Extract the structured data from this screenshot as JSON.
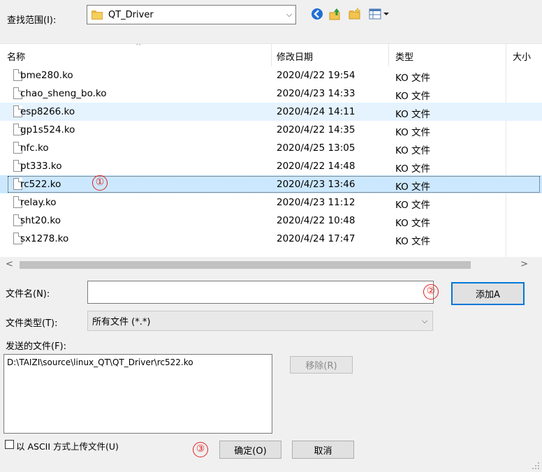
{
  "look_in": {
    "label": "查找范围(I):",
    "folder": "QT_Driver"
  },
  "columns": {
    "name": "名称",
    "date": "修改日期",
    "type": "类型",
    "size": "大小"
  },
  "files": [
    {
      "name": "bme280.ko",
      "date": "2020/4/22 19:54",
      "type": "KO 文件",
      "state": "normal"
    },
    {
      "name": "chao_sheng_bo.ko",
      "date": "2020/4/23 14:33",
      "type": "KO 文件",
      "state": "normal"
    },
    {
      "name": "esp8266.ko",
      "date": "2020/4/24 14:11",
      "type": "KO 文件",
      "state": "hover"
    },
    {
      "name": "gp1s524.ko",
      "date": "2020/4/22 14:35",
      "type": "KO 文件",
      "state": "normal"
    },
    {
      "name": "nfc.ko",
      "date": "2020/4/25 13:05",
      "type": "KO 文件",
      "state": "normal"
    },
    {
      "name": "pt333.ko",
      "date": "2020/4/22 14:48",
      "type": "KO 文件",
      "state": "normal"
    },
    {
      "name": "rc522.ko",
      "date": "2020/4/23 13:46",
      "type": "KO 文件",
      "state": "selected"
    },
    {
      "name": "relay.ko",
      "date": "2020/4/23 11:12",
      "type": "KO 文件",
      "state": "normal"
    },
    {
      "name": "sht20.ko",
      "date": "2020/4/22 10:48",
      "type": "KO 文件",
      "state": "normal"
    },
    {
      "name": "sx1278.ko",
      "date": "2020/4/24 17:47",
      "type": "KO 文件",
      "state": "normal"
    }
  ],
  "filename": {
    "label": "文件名(N):",
    "value": "",
    "add_button": "添加A"
  },
  "filetype": {
    "label": "文件类型(T):",
    "value": "所有文件 (*.*)"
  },
  "sent_files": {
    "label": "发送的文件(F):",
    "items": [
      "D:\\TAIZI\\source\\linux_QT\\QT_Driver\\rc522.ko"
    ],
    "remove_button": "移除(R)"
  },
  "ascii_checkbox": {
    "label": "以 ASCII 方式上传文件(U)",
    "checked": false
  },
  "ok_button": "确定(O)",
  "cancel_button": "取消",
  "annotations": [
    "①",
    "②",
    "③"
  ],
  "colors": {
    "hover_row": "#e5f3ff",
    "selected_row": "#cce8ff",
    "annotation": "#e02020",
    "accent": "#0078d7"
  }
}
